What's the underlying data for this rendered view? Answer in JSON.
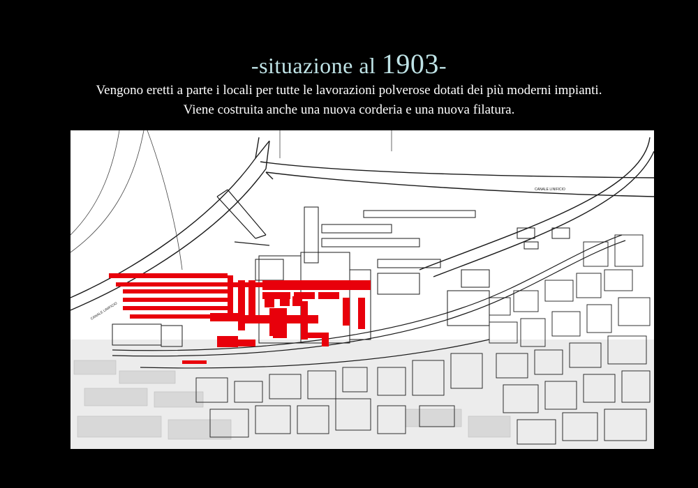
{
  "title": {
    "prefix": "-situazione al ",
    "year": "1903",
    "suffix": "-"
  },
  "subtitle": {
    "line1": "Vengono eretti a parte i locali per tutte le lavorazioni polverose dotati dei più moderni impianti.",
    "line2": "Viene costruita anche una nuova corderia e una nuova filatura."
  },
  "map": {
    "labels": {
      "canal_right": "CANALE LINIFICIO",
      "canal_left": "CANALE LINIFICIO"
    },
    "colors": {
      "highlight": "#e8000b",
      "linework": "#1a1a1a",
      "background": "#ffffff",
      "faded_city": "#cfcfcf"
    }
  }
}
